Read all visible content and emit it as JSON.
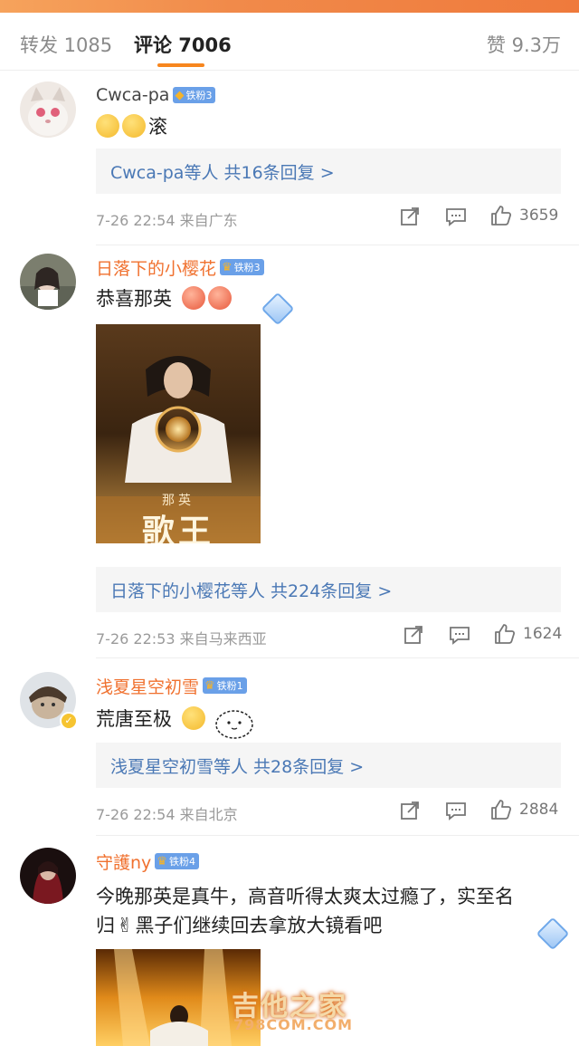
{
  "tabs": {
    "repost": "转发 1085",
    "comments": "评论 7006",
    "likes": "赞 9.3万"
  },
  "comments": [
    {
      "username": "Cwca-pa",
      "fan_badge": "铁粉3",
      "text": "滚",
      "reply_summary": "Cwca-pa等人  共16条回复 >",
      "meta": "7-26 22:54 来自广东",
      "likes": "3659"
    },
    {
      "username": "日落下的小樱花",
      "fan_badge": "铁粉3",
      "text": "恭喜那英",
      "photo_caption_name": "那英",
      "photo_caption_title": "歌王",
      "reply_summary": "日落下的小樱花等人  共224条回复 >",
      "meta": "7-26 22:53 来自马来西亚",
      "likes": "1624"
    },
    {
      "username": "浅夏星空初雪",
      "fan_badge": "铁粉1",
      "text": "荒唐至极",
      "reply_summary": "浅夏星空初雪等人  共28条回复 >",
      "meta": "7-26 22:54 来自北京",
      "likes": "2884"
    },
    {
      "username": "守護ny",
      "fan_badge": "铁粉4",
      "text_line1": "今晚那英是真牛，高音听得太爽太过瘾了，实至名",
      "text_line2_pre": "归",
      "text_line2_post": "黑子们继续回去拿放大镜看吧"
    }
  ],
  "watermark": {
    "big": "吉他之家",
    "small": "798COM.COM"
  },
  "colors": {
    "accent": "#f7861e",
    "link": "#4a78b5",
    "username_orange": "#f0712f",
    "fan_badge": "#6aa0e8"
  },
  "icons": [
    "share-icon",
    "comment-icon",
    "thumbs-up-icon",
    "verified-badge-icon",
    "diamond-badge-icon"
  ]
}
